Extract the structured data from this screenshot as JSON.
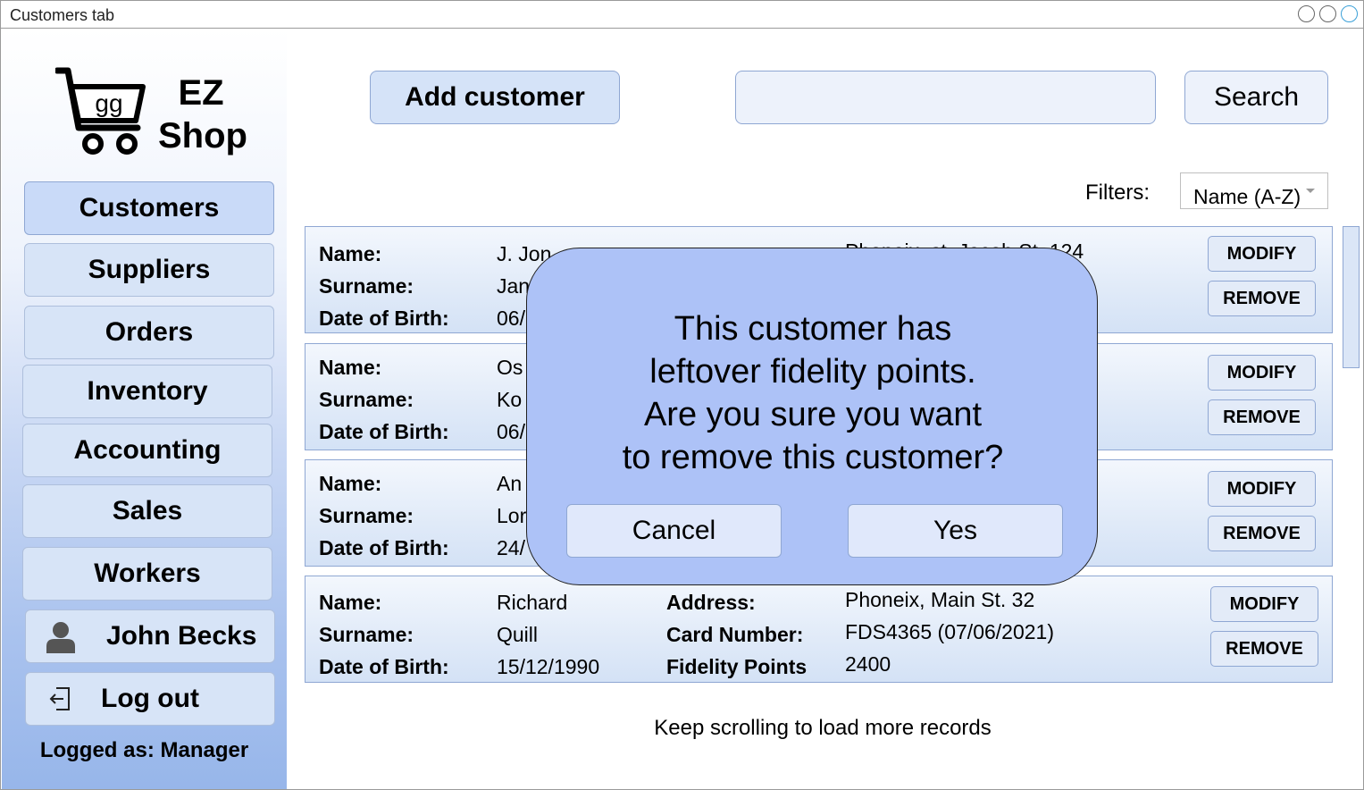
{
  "window": {
    "title": "Customers tab"
  },
  "brand": {
    "line1": "EZ",
    "line2": "Shop",
    "cart_text": "gg"
  },
  "sidebar": {
    "items": [
      {
        "label": "Customers",
        "active": true
      },
      {
        "label": "Suppliers"
      },
      {
        "label": "Orders"
      },
      {
        "label": "Inventory"
      },
      {
        "label": "Accounting"
      },
      {
        "label": "Sales"
      },
      {
        "label": "Workers"
      }
    ],
    "user_name": "John Becks",
    "logout_label": "Log out",
    "logged_as": "Logged as: Manager"
  },
  "toolbar": {
    "add_label": "Add customer",
    "search_value": "",
    "search_label": "Search",
    "filters_label": "Filters:",
    "filter_value": "Name (A-Z)"
  },
  "labels": {
    "name": "Name:",
    "surname": "Surname:",
    "dob": "Date of Birth:",
    "address": "Address:",
    "card": "Card Number:",
    "points": "Fidelity Points",
    "modify": "MODIFY",
    "remove": "REMOVE"
  },
  "records": [
    {
      "name": "J. Jon",
      "surname": "Jan",
      "dob": "06/",
      "address": "Phoneix, st. Jacob St. 124"
    },
    {
      "name": "Os",
      "surname": "Ko",
      "dob": "06/"
    },
    {
      "name": "An",
      "surname": "Lor",
      "dob": "24/"
    },
    {
      "name": "Richard",
      "surname": "Quill",
      "dob": "15/12/1990",
      "address": "Phoneix, Main St. 32",
      "card": "FDS4365 (07/06/2021)",
      "points": "2400"
    }
  ],
  "footer_note": "Keep scrolling to load more records",
  "dialog": {
    "message_lines": [
      "This customer has",
      "leftover fidelity points.",
      "Are you sure you want",
      "to remove this customer?"
    ],
    "cancel_label": "Cancel",
    "yes_label": "Yes"
  },
  "colors": {
    "accent": "#adc2f7",
    "button_bg": "#d7e4f7",
    "border": "#8fa7d3"
  }
}
